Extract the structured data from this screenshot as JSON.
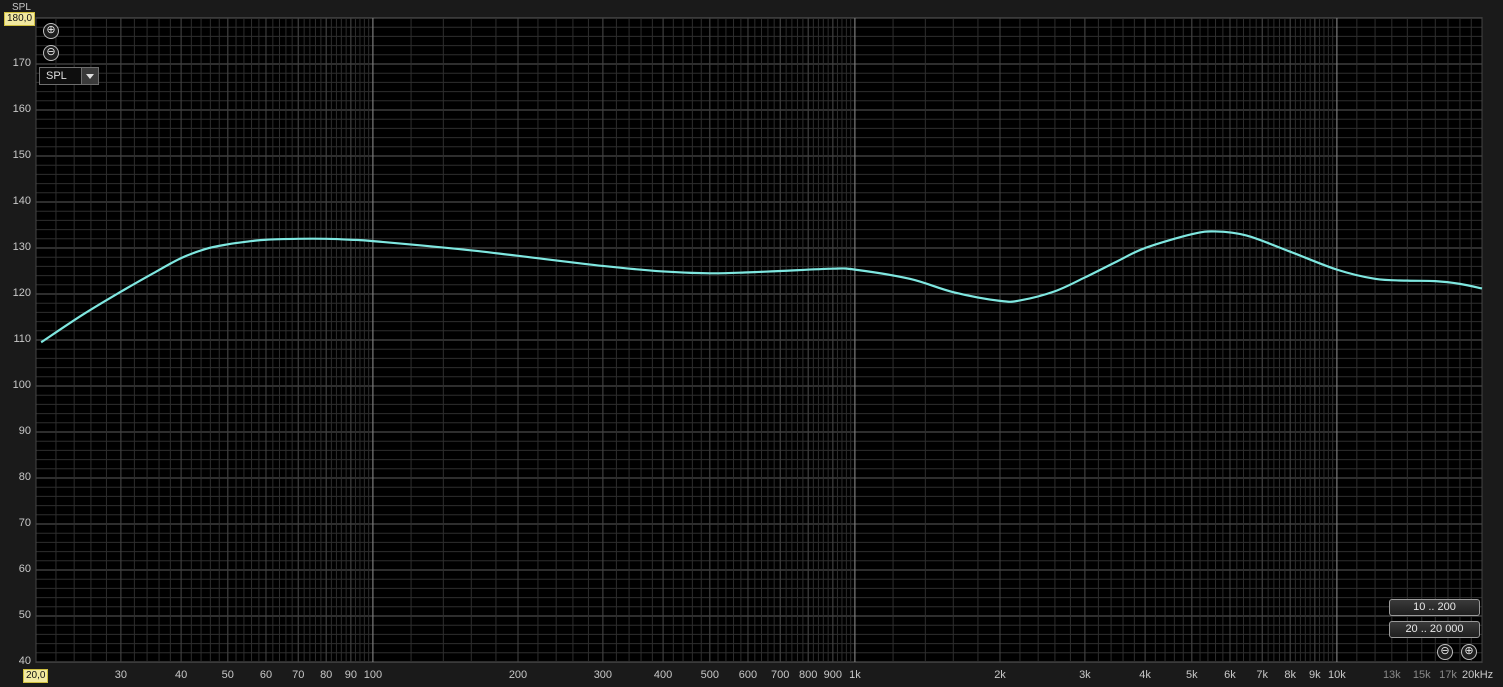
{
  "axis": {
    "y_title": "SPL",
    "y_max_badge": "180,0",
    "x_min_badge": "20,0"
  },
  "controls": {
    "zoom_in_glyph": "⊕",
    "zoom_out_glyph": "⊖",
    "mode_select_value": "SPL",
    "range_buttons": [
      "10 .. 200",
      "20 .. 20 000"
    ],
    "bottom_zoom_out_glyph": "⊖",
    "bottom_zoom_in_glyph": "⊕"
  },
  "colors": {
    "plot_background": "#000000",
    "grid_major": "#5c5c5c",
    "grid_minor": "#2e2e2e",
    "curve": "#7fe7e0"
  },
  "chart_data": {
    "type": "line",
    "x_scale": "log",
    "xlim": [
      20,
      20000
    ],
    "ylim": [
      40,
      180
    ],
    "ylabel": "SPL",
    "y_ticks": [
      40,
      50,
      60,
      70,
      80,
      90,
      100,
      110,
      120,
      130,
      140,
      150,
      160,
      170
    ],
    "y_tick_labels": [
      "40",
      "50",
      "60",
      "70",
      "80",
      "90",
      "100",
      "110",
      "120",
      "130",
      "140",
      "150",
      "160",
      "170"
    ],
    "x_ticks": [
      30,
      40,
      50,
      60,
      70,
      80,
      90,
      100,
      200,
      300,
      400,
      500,
      600,
      700,
      800,
      900,
      1000,
      2000,
      3000,
      4000,
      5000,
      6000,
      7000,
      8000,
      9000,
      10000,
      13000,
      15000,
      17000,
      20000
    ],
    "x_tick_labels": [
      "30",
      "40",
      "50",
      "60",
      "70",
      "80",
      "90",
      "100",
      "200",
      "300",
      "400",
      "500",
      "600",
      "700",
      "800",
      "900",
      "1k",
      "2k",
      "3k",
      "4k",
      "5k",
      "6k",
      "7k",
      "8k",
      "9k",
      "10k",
      "13k",
      "15k",
      "17k",
      "20kHz"
    ],
    "x_dim_labels": [
      "13k",
      "15k",
      "17k"
    ],
    "series": [
      {
        "x": [
          20.5,
          25,
          30,
          35,
          40,
          45,
          50,
          55,
          60,
          70,
          80,
          90,
          100,
          150,
          200,
          300,
          400,
          500,
          600,
          700,
          900,
          1000,
          1300,
          1600,
          2000,
          2200,
          2600,
          3000,
          3500,
          4000,
          5000,
          5600,
          6500,
          8000,
          10000,
          12000,
          14000,
          16000,
          18000,
          20000
        ],
        "y": [
          109.5,
          115.5,
          120.5,
          124.5,
          127.8,
          129.8,
          130.8,
          131.4,
          131.8,
          132.0,
          132.0,
          131.8,
          131.5,
          129.8,
          128.3,
          126.1,
          124.9,
          124.5,
          124.7,
          125.0,
          125.5,
          125.3,
          123.3,
          120.4,
          118.5,
          118.6,
          120.6,
          123.6,
          127.1,
          130.0,
          133.0,
          133.6,
          132.7,
          129.2,
          125.3,
          123.3,
          122.9,
          122.8,
          122.2,
          121.2
        ]
      }
    ]
  }
}
